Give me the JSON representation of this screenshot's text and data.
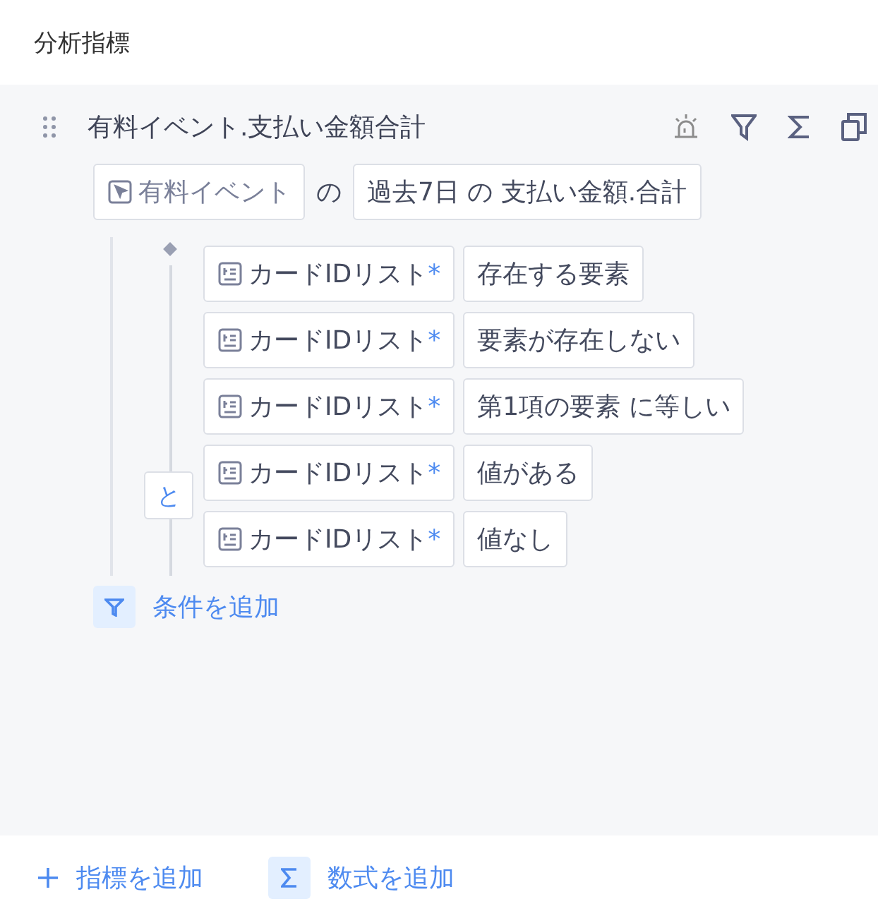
{
  "header": {
    "title": "分析指標"
  },
  "metric": {
    "title": "有料イベント.支払い金額合計",
    "event": "有料イベント",
    "joiner": "の",
    "measure": "過去7日 の 支払い金額.合計",
    "logic": "と",
    "conditions": [
      {
        "field": "カードIDリスト",
        "required_mark": "*",
        "operator": "存在する要素"
      },
      {
        "field": "カードIDリスト",
        "required_mark": "*",
        "operator": "要素が存在しない"
      },
      {
        "field": "カードIDリスト",
        "required_mark": "*",
        "operator": "第1項の要素 に等しい"
      },
      {
        "field": "カードIDリスト",
        "required_mark": "*",
        "operator": "値がある"
      },
      {
        "field": "カードIDリスト",
        "required_mark": "*",
        "operator": "値なし"
      }
    ],
    "add_condition": "条件を追加"
  },
  "footer": {
    "add_metric": "指標を追加",
    "add_formula": "数式を追加"
  }
}
